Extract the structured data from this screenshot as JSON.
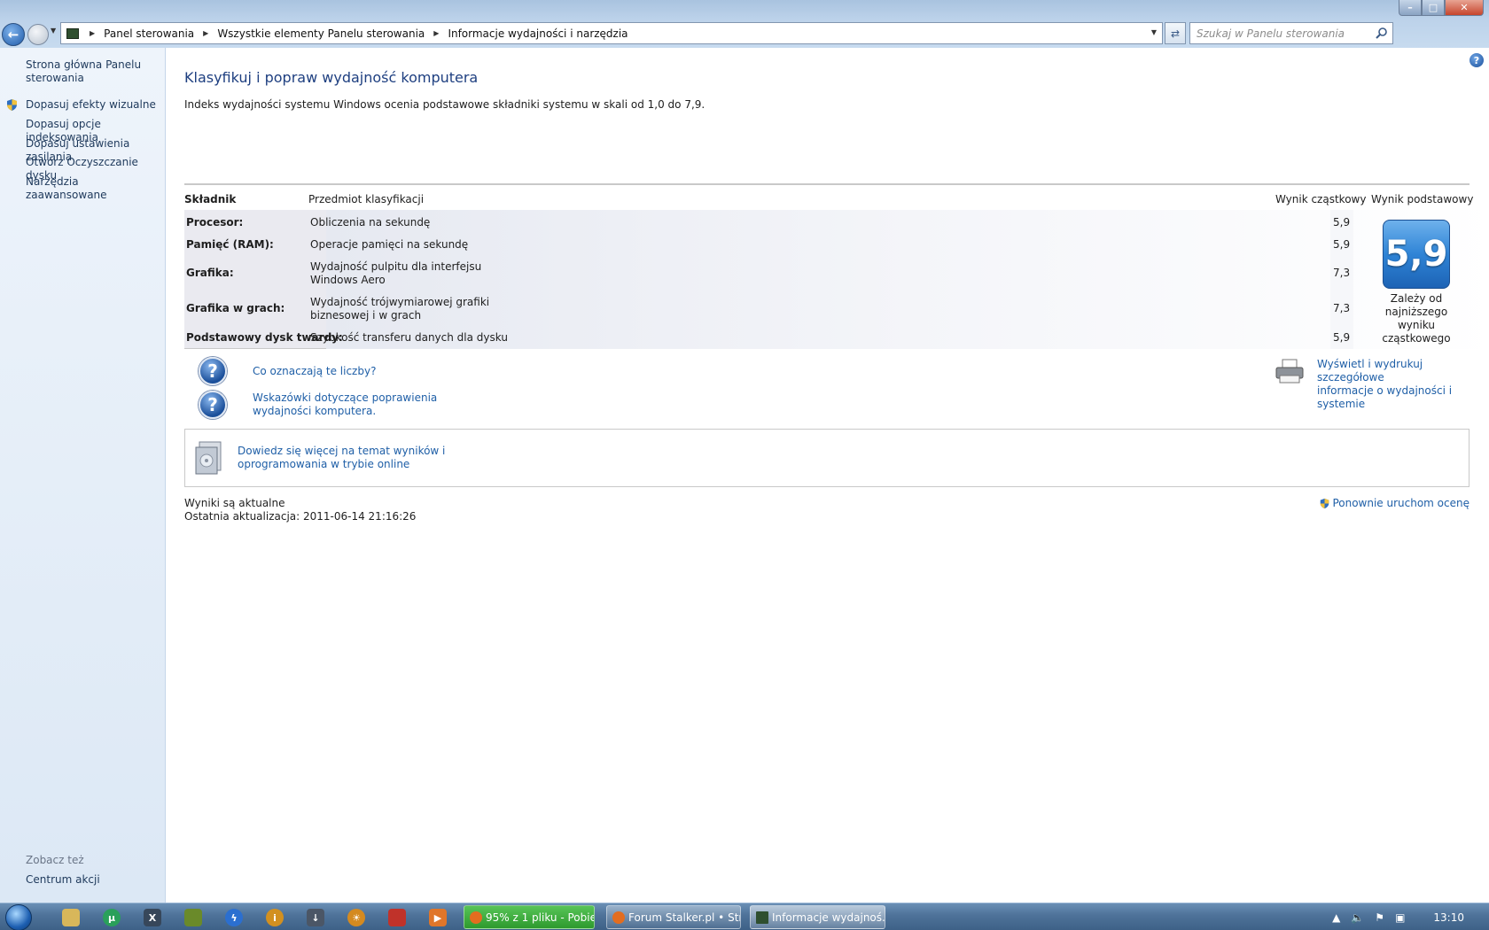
{
  "window": {
    "buttons": {
      "minimize": "–",
      "maximize": "□",
      "close": "✕"
    }
  },
  "address": {
    "breadcrumbs": [
      "Panel sterowania",
      "Wszystkie elementy Panelu sterowania",
      "Informacje wydajności i narzędzia"
    ],
    "search_placeholder": "Szukaj w Panelu sterowania"
  },
  "sidebar": {
    "home": "Strona główna Panelu sterowania",
    "items": [
      {
        "label": "Dopasuj efekty wizualne",
        "shield": true
      },
      {
        "label": "Dopasuj opcje indeksowania",
        "shield": false
      },
      {
        "label": "Dopasuj ustawienia zasilania",
        "shield": false
      },
      {
        "label": "Otwórz Oczyszczanie dysku",
        "shield": false
      },
      {
        "label": "Narzędzia zaawansowane",
        "shield": false
      }
    ],
    "see_also": "Zobacz też",
    "see_also_items": [
      "Centrum akcji"
    ]
  },
  "main": {
    "title": "Klasyfikuj i popraw wydajność komputera",
    "intro": "Indeks wydajności systemu Windows ocenia podstawowe składniki systemu w skali od 1,0 do 7,9.",
    "headers": {
      "component": "Składnik",
      "rated": "Przedmiot klasyfikacji",
      "subscore": "Wynik cząstkowy",
      "basescore": "Wynik podstawowy"
    },
    "rows": [
      {
        "component": "Procesor:",
        "desc": [
          "Obliczenia na sekundę"
        ],
        "score": "5,9"
      },
      {
        "component": "Pamięć (RAM):",
        "desc": [
          "Operacje pamięci na sekundę"
        ],
        "score": "5,9"
      },
      {
        "component": "Grafika:",
        "desc": [
          "Wydajność pulpitu dla interfejsu",
          "Windows Aero"
        ],
        "score": "7,3"
      },
      {
        "component": "Grafika w grach:",
        "desc": [
          "Wydajność trójwymiarowej grafiki",
          "biznesowej i w grach"
        ],
        "score": "7,3"
      },
      {
        "component": "Podstawowy dysk twardy:",
        "desc": [
          "Szybkość transferu danych dla dysku"
        ],
        "score": "5,9"
      }
    ],
    "base_score": "5,9",
    "base_note": [
      "Zależy od",
      "najniższego",
      "wyniku",
      "cząstkowego"
    ],
    "links": {
      "what_mean": "Co oznaczają te liczby?",
      "tips": [
        "Wskazówki dotyczące poprawienia",
        "wydajności komputera."
      ],
      "print": [
        "Wyświetl i wydrukuj szczegółowe",
        "informacje o wydajności i systemie"
      ],
      "online": [
        "Dowiedz się więcej na temat wyników i",
        "oprogramowania w trybie online"
      ]
    },
    "status": {
      "current": "Wyniki są aktualne",
      "last_update": "Ostatnia aktualizacja: 2011-06-14 21:16:26",
      "rerun": "Ponownie uruchom ocenę"
    }
  },
  "taskbar": {
    "tasks": [
      {
        "label": "95% z 1 pliku - Pobie...",
        "icon": "firefox-icon"
      },
      {
        "label": "Forum Stalker.pl • Str...",
        "icon": "firefox-icon"
      },
      {
        "label": "Informacje wydajnoś...",
        "icon": "control-panel-icon"
      }
    ],
    "clock": "13:10"
  }
}
